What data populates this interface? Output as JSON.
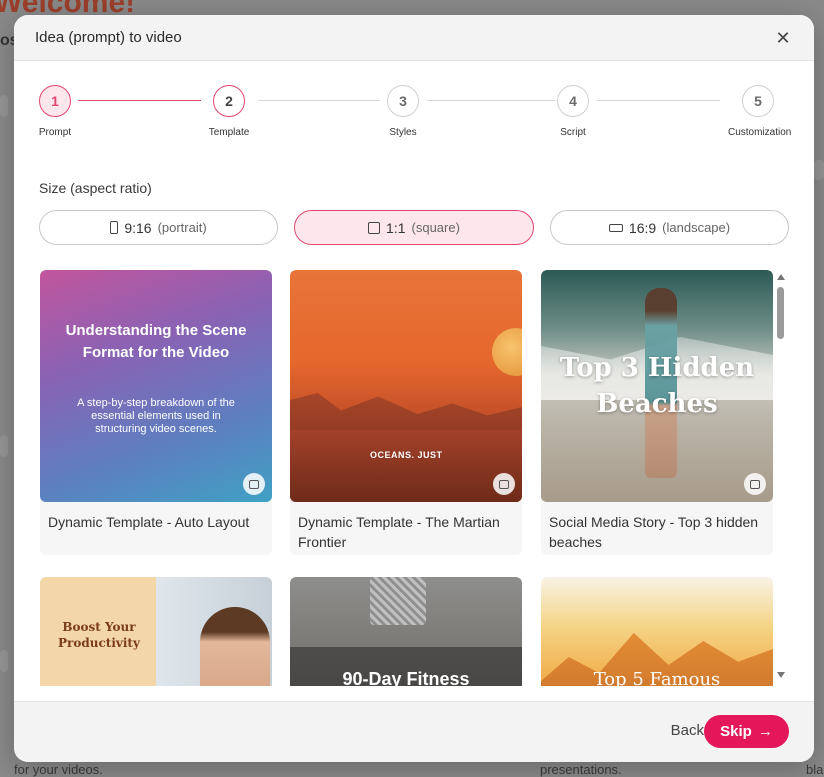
{
  "background": {
    "welcome_text": "Welcome!",
    "os_text": "os",
    "bottom_left": "for your videos.",
    "bottom_mid": "presentations.",
    "bottom_right": "bla"
  },
  "modal": {
    "title": "Idea (prompt) to video",
    "close_icon": "close-icon"
  },
  "stepper": {
    "steps": [
      {
        "number": "1",
        "label": "Prompt",
        "state": "current"
      },
      {
        "number": "2",
        "label": "Template",
        "state": "active"
      },
      {
        "number": "3",
        "label": "Styles",
        "state": "inactive"
      },
      {
        "number": "4",
        "label": "Script",
        "state": "inactive"
      },
      {
        "number": "5",
        "label": "Customization",
        "state": "inactive"
      }
    ]
  },
  "size": {
    "label": "Size (aspect ratio)",
    "options": [
      {
        "ratio": "9:16",
        "desc": "(portrait)",
        "icon": "portrait-icon",
        "selected": false
      },
      {
        "ratio": "1:1",
        "desc": "(square)",
        "icon": "square-icon",
        "selected": true
      },
      {
        "ratio": "16:9",
        "desc": "(landscape)",
        "icon": "landscape-icon",
        "selected": false
      }
    ]
  },
  "templates": [
    {
      "title": "Dynamic Template - Auto Layout",
      "thumb_heading": "Understanding the Scene Format for the Video",
      "thumb_sub": "A step-by-step breakdown of the essential elements used in structuring video scenes."
    },
    {
      "title": "Dynamic Template - The Martian Frontier",
      "thumb_text": "OCEANS. JUST"
    },
    {
      "title": "Social Media Story - Top 3 hidden beaches",
      "thumb_heading": "Top 3 Hidden Beaches"
    },
    {
      "title": "",
      "thumb_heading": "Boost Your Productivity"
    },
    {
      "title": "",
      "thumb_heading": "90-Day Fitness"
    },
    {
      "title": "",
      "thumb_heading": "Top 5 Famous"
    }
  ],
  "footer": {
    "back_label": "Back",
    "skip_label": "Skip",
    "skip_icon": "arrow-right-icon"
  },
  "colors": {
    "accent": "#e3175a",
    "accent_soft": "#fde6ec",
    "step_line_active": "#e2466e"
  }
}
